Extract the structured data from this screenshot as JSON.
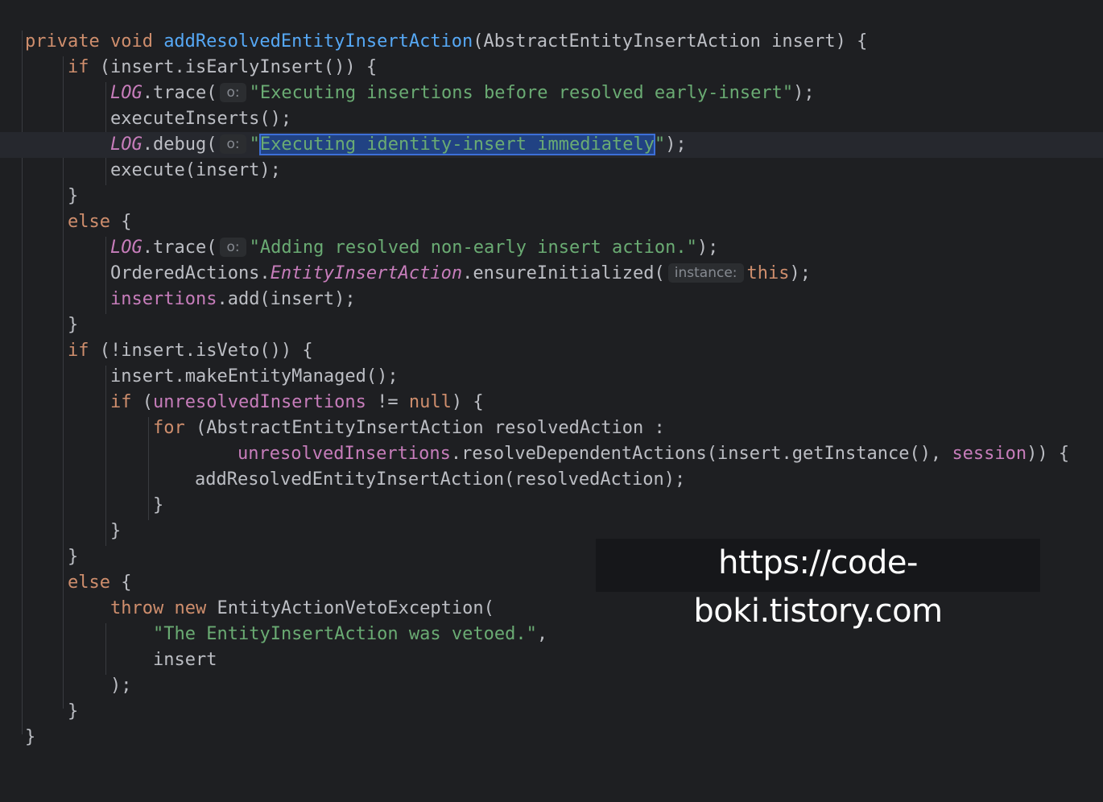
{
  "editor": {
    "hint_o": "o:",
    "hint_instance": "instance:",
    "l1": {
      "kw": "private void ",
      "fn": "addResolvedEntityInsertAction",
      "rest": "(AbstractEntityInsertAction insert) {"
    },
    "l2": {
      "kw": "if",
      "rest": " (insert.isEarlyInsert()) {"
    },
    "l3": {
      "static": "LOG",
      "call": ".trace(",
      "str": "\"Executing insertions before resolved early-insert\"",
      "end": ");"
    },
    "l4": {
      "text": "executeInserts();"
    },
    "l5": {
      "static": "LOG",
      "call": ".debug(",
      "q1": "\"",
      "sel": "Executing identity-insert immediately",
      "q2": "\"",
      "end": ");"
    },
    "l6": {
      "text": "execute(insert);"
    },
    "l7": {
      "text": "}"
    },
    "l8": {
      "kw": "else",
      "rest": " {"
    },
    "l9": {
      "static": "LOG",
      "call": ".trace(",
      "str": "\"Adding resolved non-early insert action.\"",
      "end": ");"
    },
    "l10": {
      "pre": "OrderedActions.",
      "cls": "EntityInsertAction",
      "call": ".ensureInitialized(",
      "kw": "this",
      "end": ");"
    },
    "l11": {
      "field": "insertions",
      "rest": ".add(insert);"
    },
    "l12": {
      "text": "}"
    },
    "l13": {
      "kw": "if",
      "rest": " (!insert.isVeto()) {"
    },
    "l14": {
      "text": "insert.makeEntityManaged();"
    },
    "l15": {
      "kw": "if",
      "p1": " (",
      "field": "unresolvedInsertions",
      "op": " != ",
      "kw2": "null",
      "rest": ") {"
    },
    "l16": {
      "kw": "for",
      "rest": " (AbstractEntityInsertAction resolvedAction :"
    },
    "l17": {
      "field": "unresolvedInsertions",
      "mid": ".resolveDependentActions(insert.getInstance(), ",
      "field2": "session",
      "rest": ")) {"
    },
    "l18": {
      "text": "addResolvedEntityInsertAction(resolvedAction);"
    },
    "l19": {
      "text": "}"
    },
    "l20": {
      "text": "}"
    },
    "l21": {
      "text": "}"
    },
    "l22": {
      "kw": "else",
      "rest": " {"
    },
    "l23": {
      "kw": "throw new",
      "rest": " EntityActionVetoException("
    },
    "l24": {
      "str": "\"The EntityInsertAction was vetoed.\"",
      "rest": ","
    },
    "l25": {
      "text": "insert"
    },
    "l26": {
      "text": ");"
    },
    "l27": {
      "text": "}"
    },
    "l28": {
      "text": "}"
    }
  },
  "watermark": {
    "text": "https://code-boki.tistory.com"
  }
}
